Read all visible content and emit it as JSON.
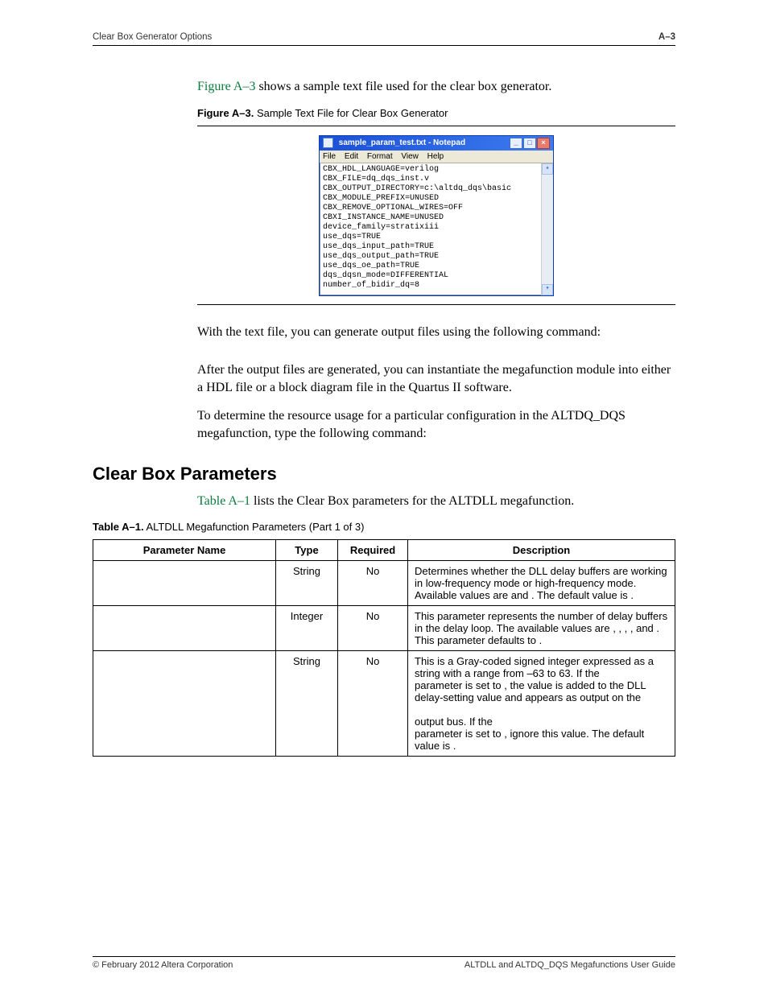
{
  "header": {
    "left": "Clear Box Generator Options",
    "right": "A–3"
  },
  "para1_prefix": "",
  "para1_link": "Figure A–3",
  "para1_rest": " shows a sample text file used for the clear box generator.",
  "figcap_bold": "Figure A–3.",
  "figcap_rest": "  Sample Text File for Clear Box Generator",
  "notepad": {
    "title": "sample_param_test.txt - Notepad",
    "menu": [
      "File",
      "Edit",
      "Format",
      "View",
      "Help"
    ],
    "lines": "CBX_HDL_LANGUAGE=verilog\nCBX_FILE=dq_dqs_inst.v\nCBX_OUTPUT_DIRECTORY=c:\\altdq_dqs\\basic\nCBX_MODULE_PREFIX=UNUSED\nCBX_REMOVE_OPTIONAL_WIRES=OFF\nCBXI_INSTANCE_NAME=UNUSED\ndevice_family=stratixiii\nuse_dqs=TRUE\nuse_dqs_input_path=TRUE\nuse_dqs_output_path=TRUE\nuse_dqs_oe_path=TRUE\ndqs_dqsn_mode=DIFFERENTIAL\nnumber_of_bidir_dq=8"
  },
  "para2": "With the text file, you can generate output files using the following command:",
  "para3": "After the output files are generated, you can instantiate the megafunction module into either a HDL file or a block diagram file in the Quartus II software.",
  "para4": "To determine the resource usage for a particular configuration in the ALTDQ_DQS megafunction, type the following command:",
  "section_title": "Clear Box Parameters",
  "para5_link": "Table A–1",
  "para5_rest": " lists the Clear Box parameters for the ALTDLL megafunction.",
  "tabcap_bold": "Table A–1.",
  "tabcap_mid": "  ALTDLL Megafunction Parameters",
  "tabcap_part": "  (Part 1 of 3)",
  "table": {
    "headers": [
      "Parameter Name",
      "Type",
      "Required",
      "Description"
    ],
    "rows": [
      {
        "name": "",
        "type": "String",
        "required": "No",
        "desc": "Determines whether the DLL delay buffers are working in low-frequency mode or high-frequency mode. Available values are        and         . The default value is        ."
      },
      {
        "name": "",
        "type": "Integer",
        "required": "No",
        "desc": "This parameter represents the number of delay buffers in the delay loop. The available values are    ,    ,    ,    , and    . This parameter defaults to     ."
      },
      {
        "name": "",
        "type": "String",
        "required": "No",
        "desc": "This is a Gray-coded signed integer expressed as a string with a range from –63 to 63. If the\n                                                         parameter is set to         , the value is added to the DLL delay-setting value and appears as output on the\n\noutput bus. If the\nparameter is set to          , ignore this value. The default value is    ."
      }
    ]
  },
  "footer": {
    "left": "© February 2012   Altera Corporation",
    "right": "ALTDLL and ALTDQ_DQS Megafunctions User Guide"
  }
}
